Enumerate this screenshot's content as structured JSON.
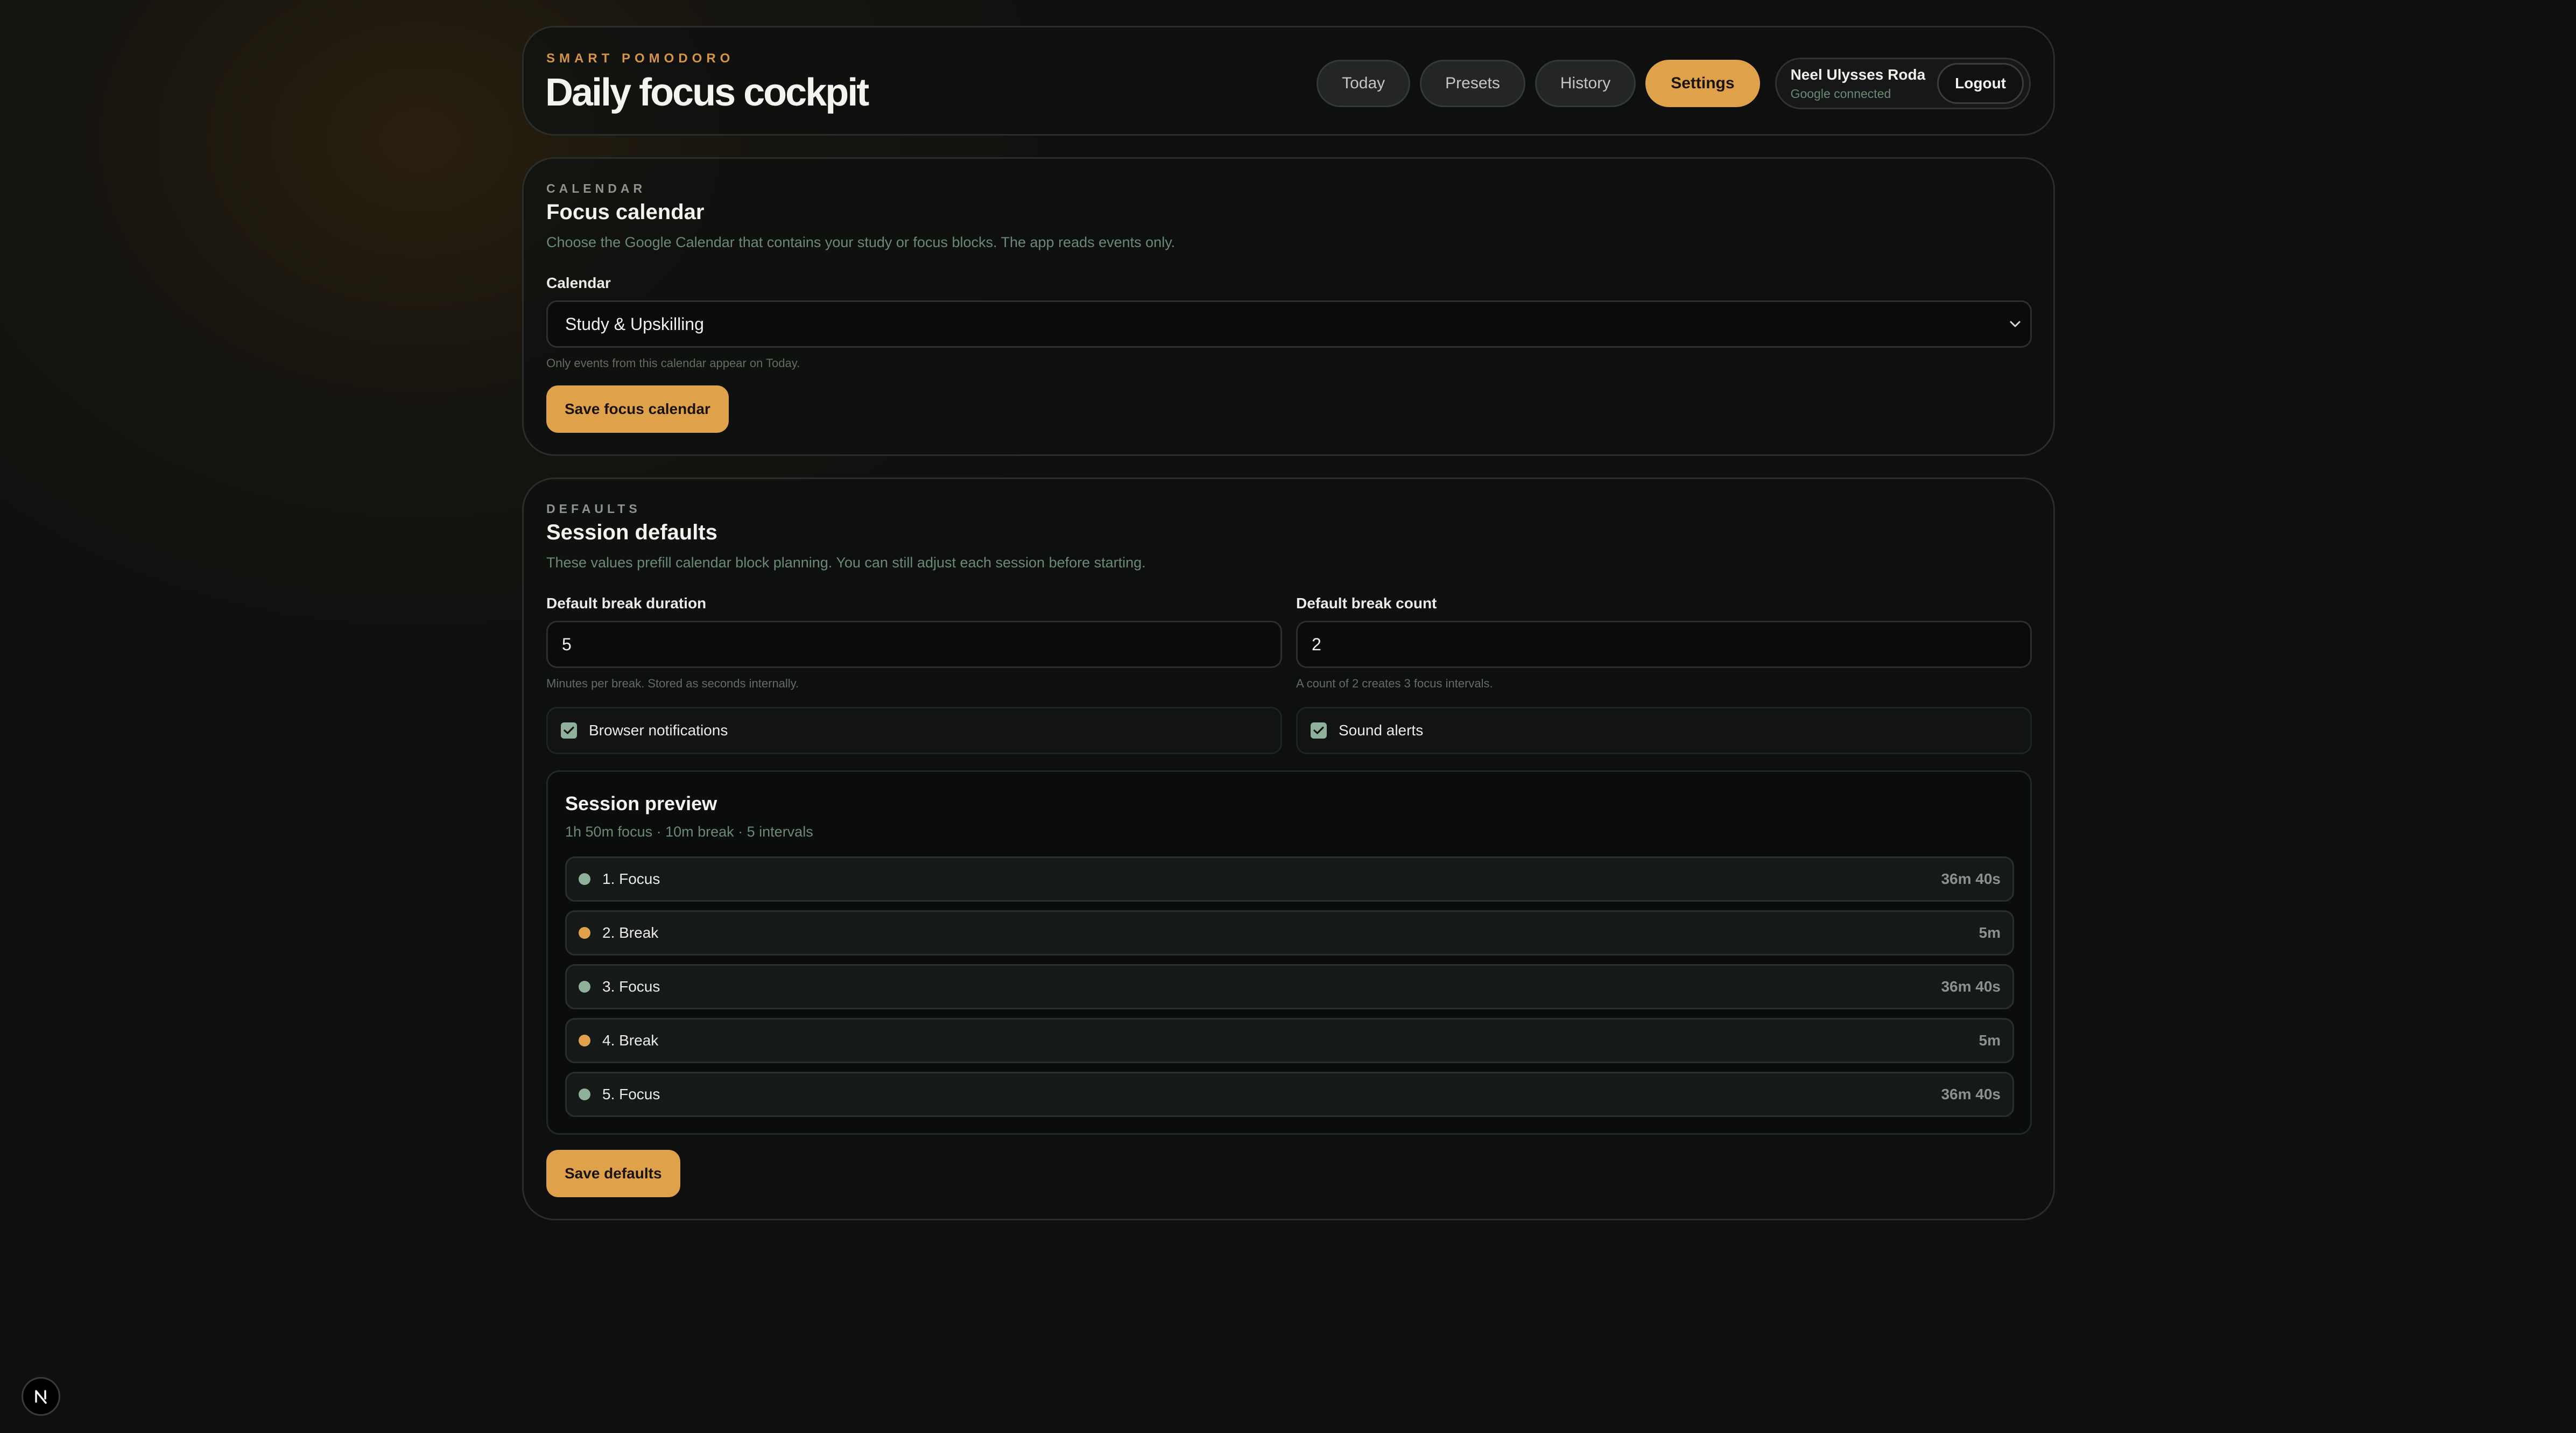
{
  "header": {
    "brand": "SMART POMODORO",
    "title": "Daily focus cockpit",
    "nav": [
      {
        "label": "Today"
      },
      {
        "label": "Presets"
      },
      {
        "label": "History"
      },
      {
        "label": "Settings",
        "active": true
      }
    ],
    "user": {
      "name": "Neel Ulysses Roda",
      "status": "Google connected"
    },
    "logout_label": "Logout"
  },
  "calendar_section": {
    "eyebrow": "CALENDAR",
    "title": "Focus calendar",
    "description": "Choose the Google Calendar that contains your study or focus blocks. The app reads events only.",
    "field_label": "Calendar",
    "selected_calendar": "Study & Upskilling",
    "hint": "Only events from this calendar appear on Today.",
    "save_label": "Save focus calendar"
  },
  "defaults_section": {
    "eyebrow": "DEFAULTS",
    "title": "Session defaults",
    "description": "These values prefill calendar block planning. You can still adjust each session before starting.",
    "break_duration": {
      "label": "Default break duration",
      "value": "5",
      "hint": "Minutes per break. Stored as seconds internally."
    },
    "break_count": {
      "label": "Default break count",
      "value": "2",
      "hint": "A count of 2 creates 3 focus intervals."
    },
    "notifications": {
      "label": "Browser notifications",
      "checked": true
    },
    "sound": {
      "label": "Sound alerts",
      "checked": true
    },
    "preview": {
      "title": "Session preview",
      "summary": "1h 50m focus · 10m break · 5 intervals",
      "intervals": [
        {
          "label": "1. Focus",
          "duration": "36m 40s",
          "kind": "focus"
        },
        {
          "label": "2. Break",
          "duration": "5m",
          "kind": "break"
        },
        {
          "label": "3. Focus",
          "duration": "36m 40s",
          "kind": "focus"
        },
        {
          "label": "4. Break",
          "duration": "5m",
          "kind": "break"
        },
        {
          "label": "5. Focus",
          "duration": "36m 40s",
          "kind": "focus"
        }
      ]
    },
    "save_label": "Save defaults"
  },
  "colors": {
    "accent": "#e0a14b",
    "focus_dot": "#8fb09a",
    "break_dot": "#e0a14b"
  },
  "icons": {
    "select": "chevron-down-icon",
    "checkbox": "check-icon",
    "corner_badge": "nextjs-logo-icon"
  }
}
